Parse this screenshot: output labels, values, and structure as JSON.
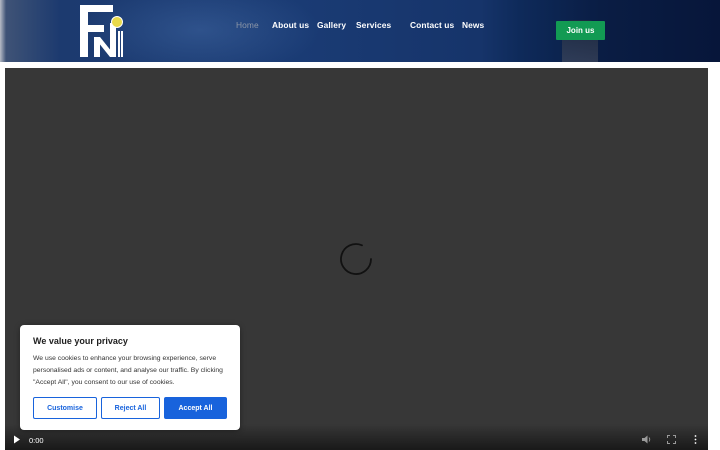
{
  "header": {
    "nav": [
      {
        "label": "Home",
        "active": true
      },
      {
        "label": "About us"
      },
      {
        "label": "Gallery"
      },
      {
        "label": "Services"
      },
      {
        "label": "Contact us"
      },
      {
        "label": "News"
      }
    ],
    "join_label": "Join us"
  },
  "video": {
    "current_time": "0:00",
    "state": "loading"
  },
  "cookie_banner": {
    "title": "We value your privacy",
    "text": "We use cookies to enhance your browsing experience, serve personalised ads or content, and analyse our traffic. By clicking \"Accept All\", you consent to our use of cookies.",
    "buttons": {
      "customise": "Customise",
      "reject": "Reject All",
      "accept": "Accept All"
    }
  },
  "colors": {
    "join_button": "#129a53",
    "cookie_accent": "#1863dc",
    "video_background": "#373737",
    "header_dark": "#0a1d44"
  },
  "icons": {
    "logo": "fn-logo",
    "spinner": "loading-spinner-icon",
    "play": "play-icon",
    "volume": "volume-icon",
    "fullscreen": "fullscreen-icon",
    "more": "more-vertical-icon"
  }
}
